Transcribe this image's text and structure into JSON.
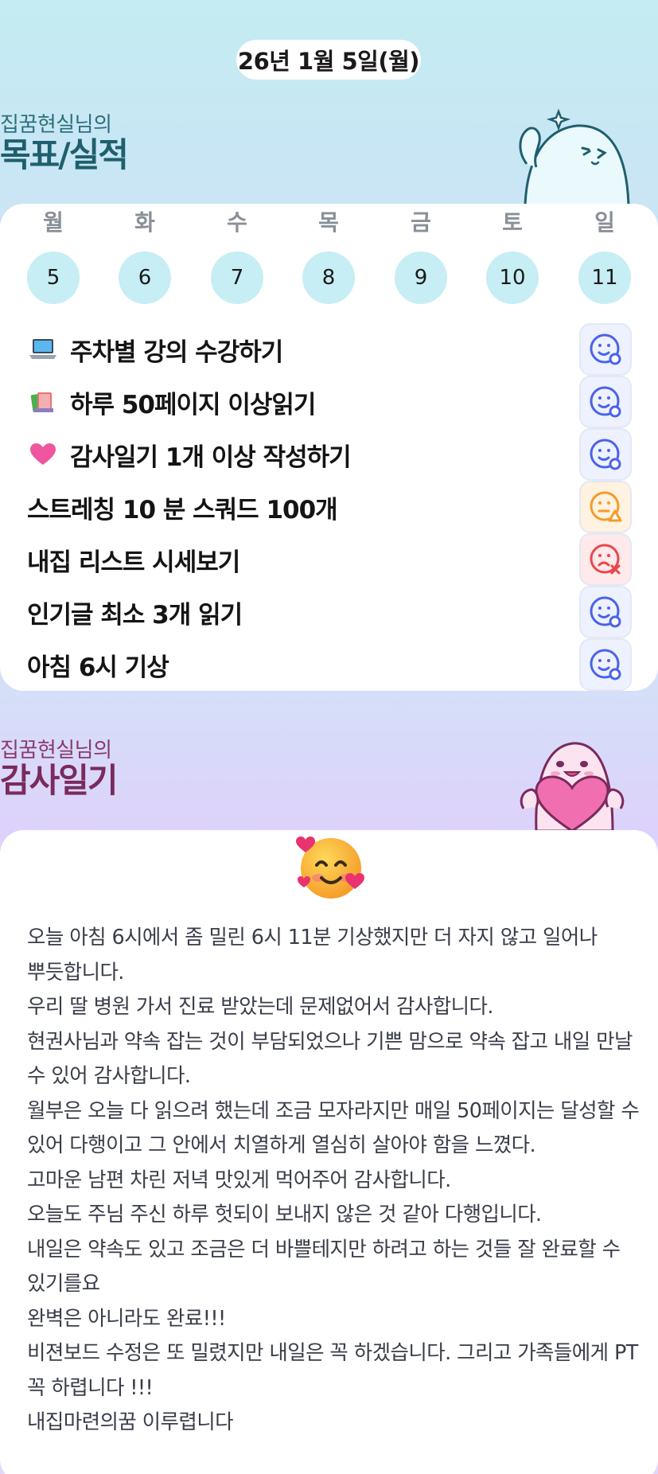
{
  "header": {
    "date": "26년 1월 5일(월)"
  },
  "goals_section": {
    "subtitle": "집꿈현실님의",
    "title": "목표/실적"
  },
  "week": [
    {
      "day": "월",
      "date": "5"
    },
    {
      "day": "화",
      "date": "6"
    },
    {
      "day": "수",
      "date": "7"
    },
    {
      "day": "목",
      "date": "8"
    },
    {
      "day": "금",
      "date": "9"
    },
    {
      "day": "토",
      "date": "10"
    },
    {
      "day": "일",
      "date": "11"
    }
  ],
  "goals": [
    {
      "emoji": "laptop-icon",
      "text": "주차별 강의 수강하기",
      "status": "good"
    },
    {
      "emoji": "books-icon",
      "text": "하루 50페이지 이상읽기",
      "status": "good"
    },
    {
      "emoji": "heart-icon",
      "text": "감사일기 1개 이상 작성하기",
      "status": "good"
    },
    {
      "emoji": "",
      "text": "스트레칭 10 분 스쿼드 100개",
      "status": "warning"
    },
    {
      "emoji": "",
      "text": "내집 리스트 시세보기",
      "status": "fail"
    },
    {
      "emoji": "",
      "text": "인기글 최소 3개 읽기",
      "status": "good"
    },
    {
      "emoji": "",
      "text": "아침 6시 기상",
      "status": "good"
    }
  ],
  "status_colors": {
    "good": "#4a63e8",
    "warning": "#f59b2a",
    "fail": "#e8474c"
  },
  "gratitude_section": {
    "subtitle": "집꿈현실님의",
    "title": "감사일기"
  },
  "gratitude": {
    "mood_icon": "smiling-face-with-hearts-icon",
    "text": "오늘 아침 6시에서 좀 밀린 6시 11분 기상했지만 더 자지 않고 일어나 뿌듯합니다.\n우리 딸 병원 가서 진료 받았는데 문제없어서 감사합니다.\n현권사님과 약속 잡는 것이 부담되었으나 기쁜 맘으로 약속 잡고 내일 만날 수 있어 감사합니다.\n월부은 오늘 다 읽으려 했는데 조금 모자라지만 매일 50페이지는 달성할 수 있어 다행이고 그 안에서 치열하게 열심히 살아야 함을 느꼈다.\n고마운 남편 차린 저녁 맛있게 먹어주어 감사합니다.\n오늘도 주님 주신 하루 헛되이 보내지 않은 것 같아 다행입니다.\n내일은 약속도 있고 조금은 더 바쁠테지만 하려고 하는 것들 잘 완료할 수 있기를요\n완벽은 아니라도 완료!!!\n비젼보드 수정은 또 밀렸지만 내일은 꼭 하겠습니다. 그리고 가족들에게 PT 꼭 하렵니다 !!!\n내집마련의꿈 이루렵니다"
  }
}
